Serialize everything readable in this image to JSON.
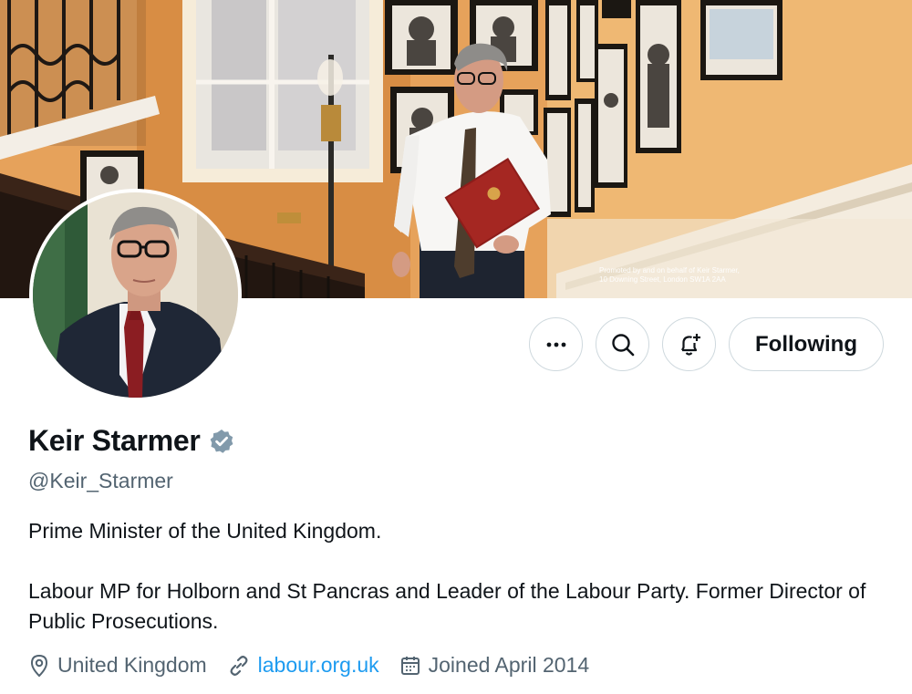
{
  "banner": {
    "credit": "Promoted by and on behalf of Keir Starmer,\n10 Downing Street, London SW1A 2AA"
  },
  "actions": {
    "more_icon": "ellipsis-icon",
    "search_icon": "search-icon",
    "notify_icon": "bell-plus-icon",
    "follow_label": "Following"
  },
  "profile": {
    "name": "Keir Starmer",
    "verified_icon": "verified-badge-icon",
    "verified_color": "#829aab",
    "handle": "@Keir_Starmer",
    "bio_line1": "Prime Minister of the United Kingdom.",
    "bio_line2": "Labour MP for Holborn and St Pancras and Leader of the Labour Party. Former Director of Public Prosecutions."
  },
  "meta": {
    "location": "United Kingdom",
    "location_icon": "location-pin-icon",
    "website": "labour.org.uk",
    "website_icon": "link-icon",
    "joined": "Joined April 2014",
    "joined_icon": "calendar-icon",
    "link_color": "#1d9bf0"
  }
}
